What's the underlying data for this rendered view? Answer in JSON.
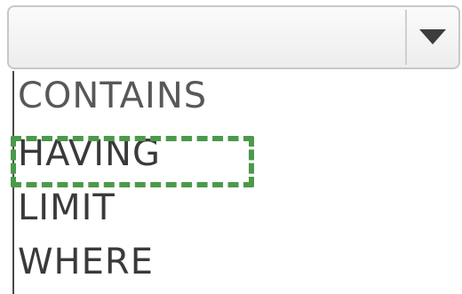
{
  "combo": {
    "value": "",
    "button_icon": "triangle-down"
  },
  "options": [
    {
      "label": "CONTAINS"
    },
    {
      "label": "HAVING"
    },
    {
      "label": "LIMIT"
    },
    {
      "label": "WHERE"
    }
  ],
  "highlight": {
    "color": "#4a9a4a",
    "target": "HAVING"
  }
}
